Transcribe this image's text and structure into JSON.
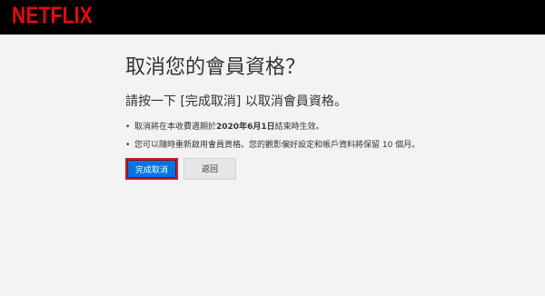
{
  "header": {
    "logo_text": "NETFLIX",
    "logo_color": "#e50914"
  },
  "main": {
    "title": "取消您的會員資格？",
    "subtitle": "請按一下 [完成取消] 以取消會員資格。",
    "bullets": [
      {
        "before": "取消將在本收費週期於",
        "bold": "2020年6月1日",
        "after": "結束時生效。"
      },
      {
        "text": "您可以隨時重新啟用會員資格。您的觀影偏好設定和帳戶資料將保留 10 個月。"
      }
    ],
    "primary_button": "完成取消",
    "secondary_button": "返回"
  },
  "colors": {
    "primary_button_bg": "#0073e6",
    "highlight_border": "#c81d2a",
    "page_bg": "#f3f3f3"
  }
}
